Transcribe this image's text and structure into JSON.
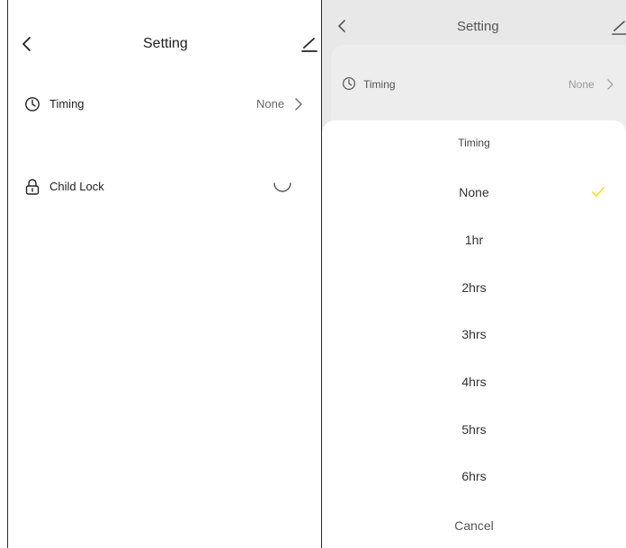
{
  "left_screen": {
    "header": {
      "title": "Setting"
    },
    "rows": {
      "timing": {
        "label": "Timing",
        "value": "None"
      },
      "child_lock": {
        "label": "Child Lock"
      }
    }
  },
  "right_screen": {
    "header": {
      "title": "Setting"
    },
    "timing_row": {
      "label": "Timing",
      "value": "None"
    },
    "sheet": {
      "title": "Timing",
      "options": [
        {
          "label": "None",
          "selected": true
        },
        {
          "label": "1hr",
          "selected": false
        },
        {
          "label": "2hrs",
          "selected": false
        },
        {
          "label": "3hrs",
          "selected": false
        },
        {
          "label": "4hrs",
          "selected": false
        },
        {
          "label": "5hrs",
          "selected": false
        },
        {
          "label": "6hrs",
          "selected": false
        }
      ],
      "cancel_label": "Cancel"
    }
  },
  "icons": {
    "back": "chevron-left-icon",
    "edit": "edit-icon",
    "clock": "clock-icon",
    "lock": "lock-icon",
    "chevron": "chevron-right-icon",
    "check": "check-icon"
  },
  "colors": {
    "check_accent": "#f2e400",
    "overlay": "#e8e8e8"
  }
}
